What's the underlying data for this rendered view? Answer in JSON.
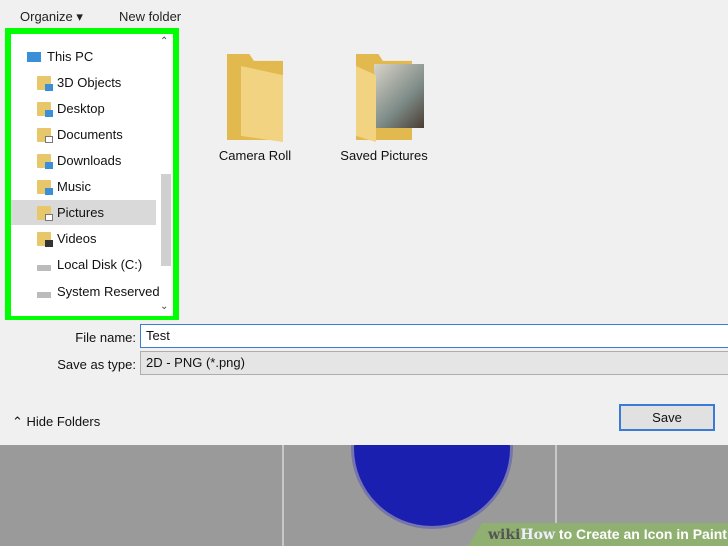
{
  "toolbar": {
    "organize": "Organize ▾",
    "new_folder": "New folder"
  },
  "nav": {
    "items": [
      {
        "label": "This PC",
        "icon": "computer-icon"
      },
      {
        "label": "3D Objects",
        "icon": "3d-objects-icon"
      },
      {
        "label": "Desktop",
        "icon": "desktop-icon"
      },
      {
        "label": "Documents",
        "icon": "documents-icon"
      },
      {
        "label": "Downloads",
        "icon": "downloads-icon"
      },
      {
        "label": "Music",
        "icon": "music-icon"
      },
      {
        "label": "Pictures",
        "icon": "pictures-icon",
        "selected": true
      },
      {
        "label": "Videos",
        "icon": "videos-icon"
      },
      {
        "label": "Local Disk (C:)",
        "icon": "drive-icon"
      },
      {
        "label": "System Reserved",
        "icon": "drive-icon"
      }
    ]
  },
  "folders": [
    {
      "label": "Camera Roll"
    },
    {
      "label": "Saved Pictures"
    }
  ],
  "file_name": {
    "label": "File name:",
    "value": "Test"
  },
  "save_type": {
    "label": "Save as type:",
    "value": "2D - PNG (*.png)"
  },
  "hide_folders": "Hide Folders",
  "save_label": "Save",
  "watermark": {
    "wiki": "wiki",
    "how": "How",
    "text": "to Create an Icon in Paint"
  },
  "colors": {
    "highlight": "#00ff00",
    "paint_circle": "#1a1fb0"
  }
}
